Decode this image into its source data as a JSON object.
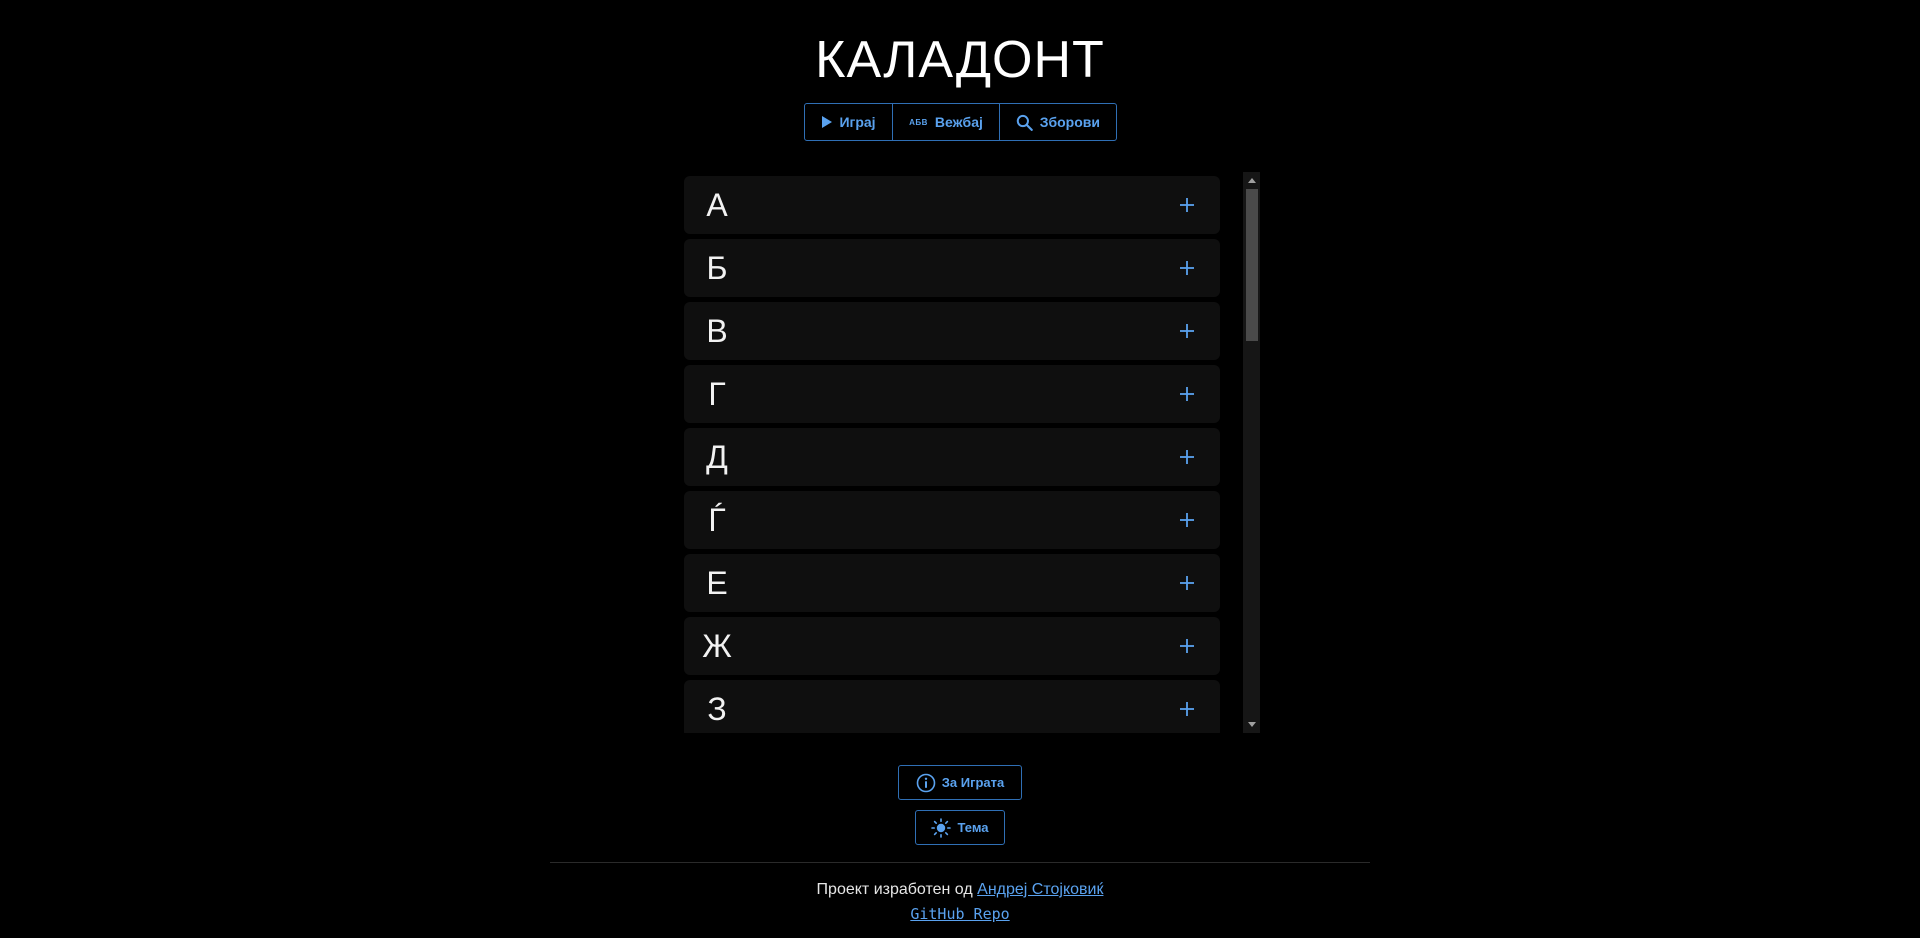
{
  "app": {
    "title": "КАЛАДОНТ"
  },
  "nav": {
    "play_label": "Играј",
    "practice_icon": "АБВ",
    "practice_label": "Вежбај",
    "words_label": "Зборови"
  },
  "letters": [
    "А",
    "Б",
    "В",
    "Г",
    "Д",
    "Ѓ",
    "Е",
    "Ж",
    "З"
  ],
  "buttons": {
    "about_label": "За Играта",
    "theme_label": "Тема"
  },
  "footer": {
    "made_by": "Проект изработен од",
    "author": "Андреј Стојковиќ",
    "repo": "GitHub Repo"
  },
  "colors": {
    "accent": "#5aa2ef",
    "border": "#2f6fb5",
    "background": "#000000",
    "row_background": "#0f0f0f"
  },
  "icons": {
    "play": "play-icon",
    "search": "search-icon",
    "info": "info-icon",
    "theme": "sun-icon",
    "expand": "plus-icon"
  }
}
